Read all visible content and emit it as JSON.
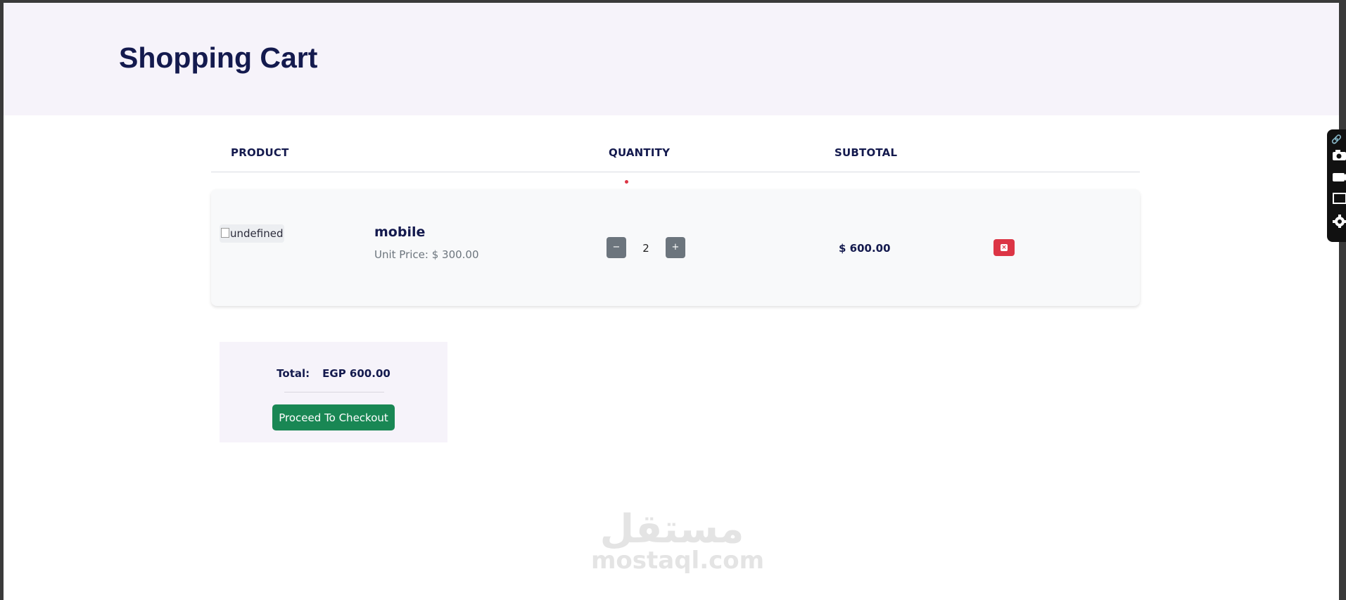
{
  "page": {
    "title": "Shopping Cart"
  },
  "table": {
    "columns": [
      "PRODUCT",
      "QUANTITY",
      "SUBTOTAL"
    ]
  },
  "cart_items": [
    {
      "image_alt": "undefined",
      "name": "mobile",
      "unit_price_text": "Unit Price: $ 300.00",
      "quantity": "2",
      "decrement_label": "−",
      "increment_label": "+",
      "subtotal": "$ 600.00",
      "remove_icon": "close-icon"
    }
  ],
  "summary": {
    "total_label": "Total:",
    "total_value": "EGP 600.00",
    "checkout_label": "Proceed To Checkout"
  },
  "watermark": {
    "arabic": "مستقل",
    "latin": "mostaql.com"
  },
  "toolbar_icons": [
    "link-icon",
    "camera-icon",
    "video-icon",
    "window-icon",
    "gear-icon"
  ],
  "colors": {
    "title": "#141a4e",
    "header_band": "#f6f3fa",
    "row_background": "#f8f9fa",
    "qty_button": "#6c757d",
    "remove_button": "#dc3545",
    "checkout_button": "#198754"
  }
}
